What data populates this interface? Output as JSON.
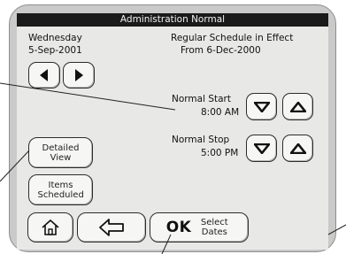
{
  "header": {
    "title": "Administration Normal"
  },
  "date": {
    "weekday": "Wednesday",
    "date": "5-Sep-2001"
  },
  "schedule": {
    "status": "Regular Schedule in Effect",
    "from": "From  6-Dec-2000"
  },
  "normal_start": {
    "label": "Normal Start",
    "time": "8:00 AM"
  },
  "normal_stop": {
    "label": "Normal Stop",
    "time": "5:00 PM"
  },
  "buttons": {
    "detailed_view": "Detailed View",
    "items_scheduled": "Items Scheduled",
    "ok": "OK",
    "select_dates": "Select Dates"
  },
  "icons": {
    "prev": "triangle-left-icon",
    "next": "triangle-right-icon",
    "down": "triangle-down-icon",
    "up": "triangle-up-icon",
    "home": "home-icon",
    "back": "back-arrow-icon"
  },
  "colors": {
    "titlebar": "#1a1a1a",
    "screen": "#e8e8e6",
    "bezel": "#c9cac9"
  }
}
